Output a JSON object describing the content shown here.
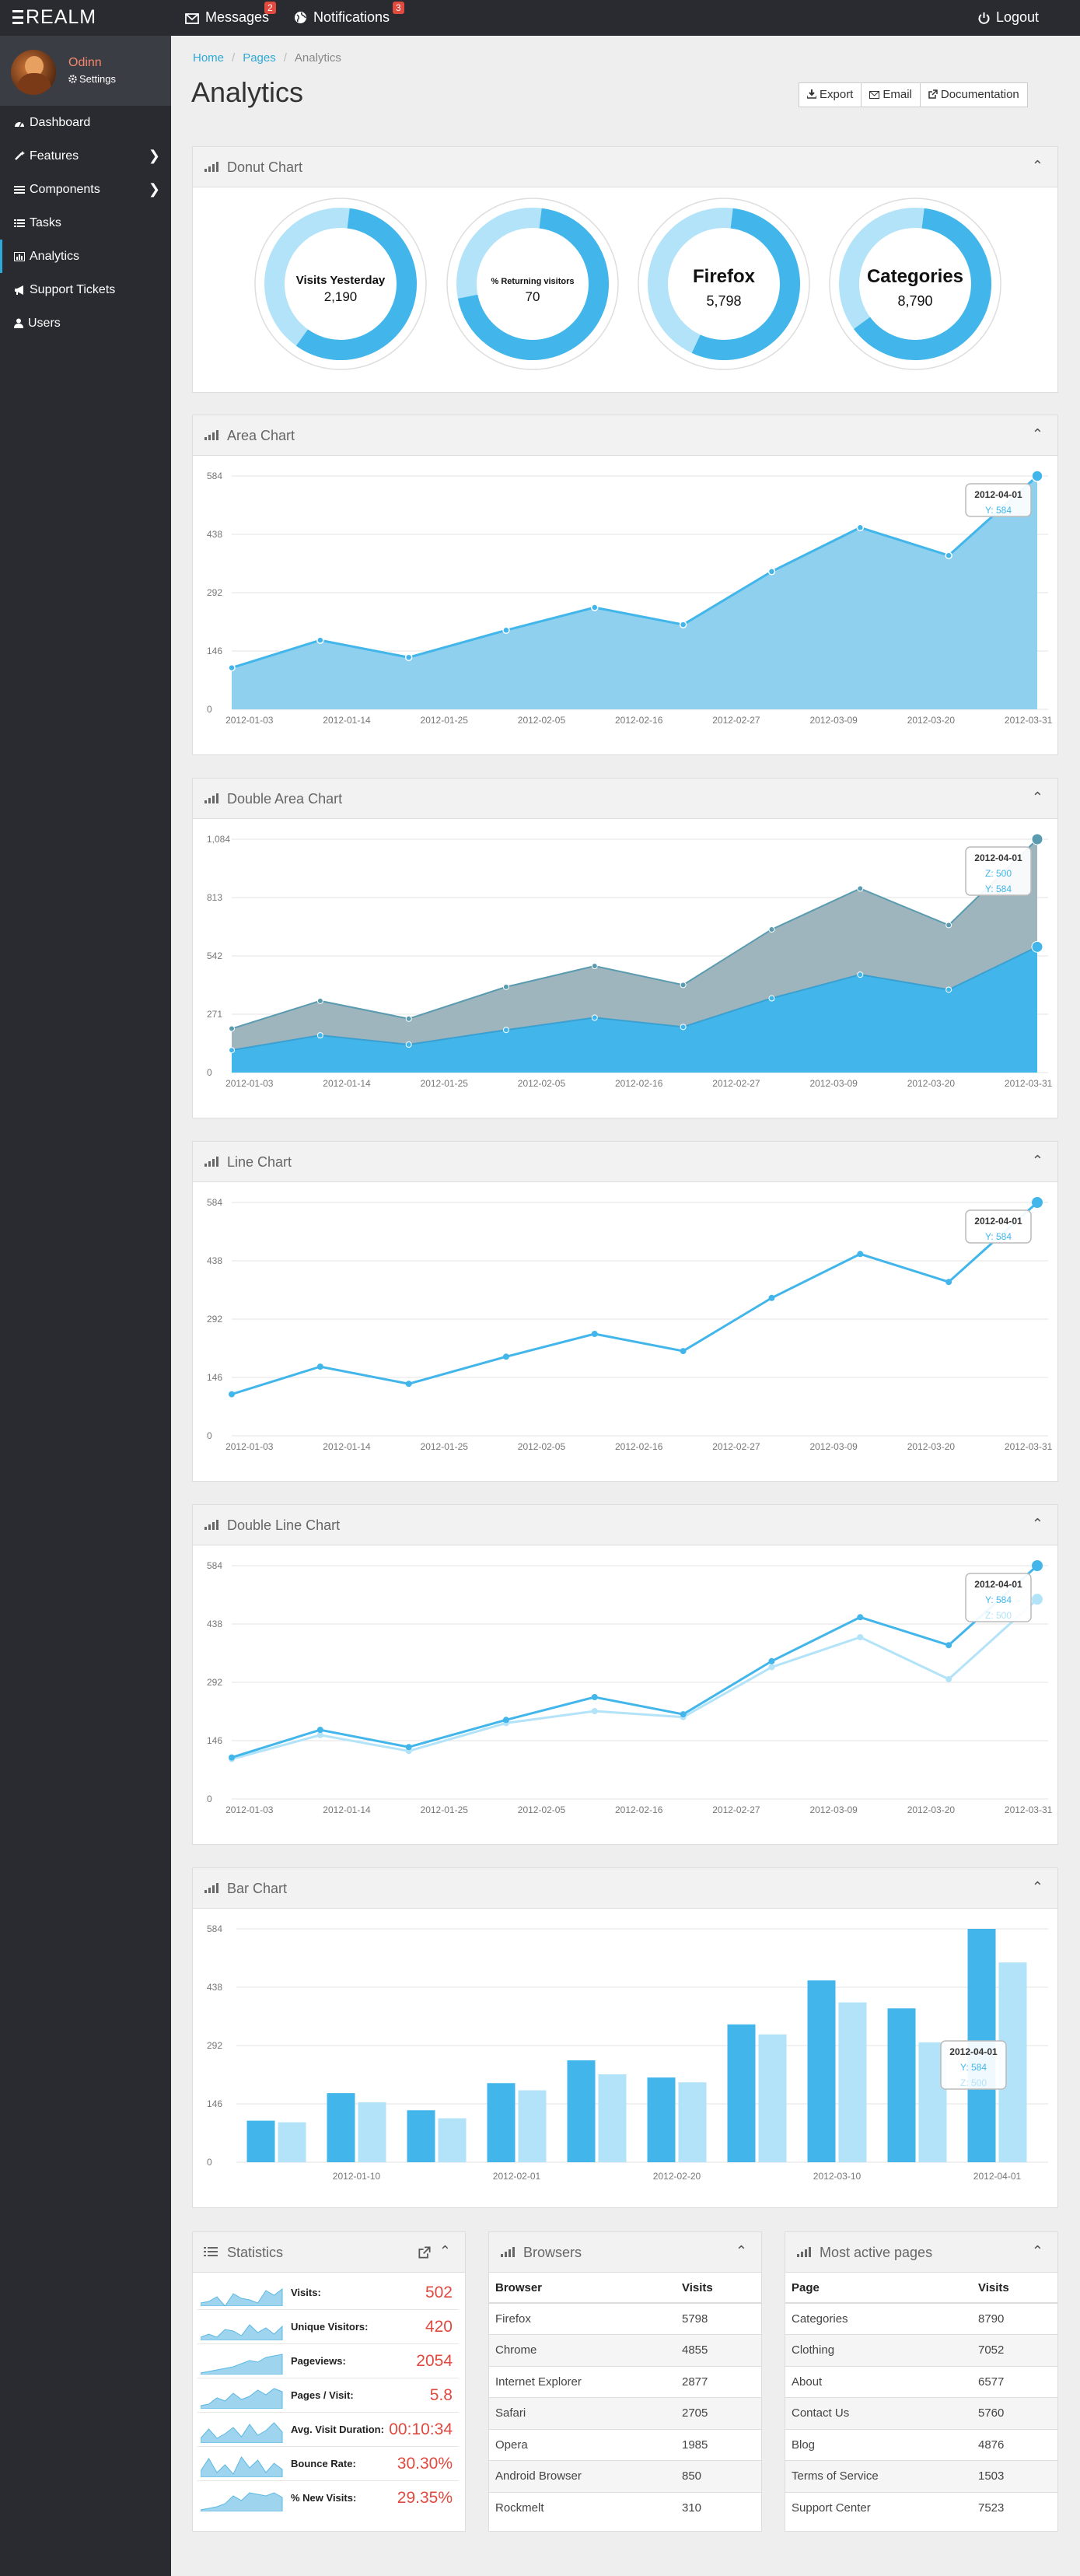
{
  "app": {
    "brand": "REALM"
  },
  "topbar": {
    "messages_label": "Messages",
    "messages_badge": "2",
    "notifications_label": "Notifications",
    "notifications_badge": "3",
    "logout_label": "Logout"
  },
  "sidebar": {
    "user_name": "Odinn",
    "settings_label": "Settings",
    "items": [
      {
        "label": "Dashboard",
        "icon": "dashboard-icon"
      },
      {
        "label": "Features",
        "icon": "magic-icon"
      },
      {
        "label": "Components",
        "icon": "bars-icon"
      },
      {
        "label": "Tasks",
        "icon": "list-icon"
      },
      {
        "label": "Analytics",
        "icon": "bar-chart-icon"
      },
      {
        "label": "Support Tickets",
        "icon": "bullhorn-icon"
      },
      {
        "label": "Users",
        "icon": "user-icon"
      }
    ]
  },
  "breadcrumb": {
    "home": "Home",
    "pages": "Pages",
    "current": "Analytics"
  },
  "page": {
    "title": "Analytics"
  },
  "actions": {
    "export": "Export",
    "email": "Email",
    "documentation": "Documentation"
  },
  "colors": {
    "accent": "#2ea8d6",
    "series_a": "#42b6ea",
    "series_b": "#b3e3f8",
    "danger": "#e04a3f",
    "area_fill": "#8fd0ee",
    "double_area_upper": "#9eb5bd"
  },
  "panels": {
    "donut": "Donut Chart",
    "area": "Area Chart",
    "double_area": "Double Area Chart",
    "line": "Line Chart",
    "double_line": "Double Line Chart",
    "bar": "Bar Chart",
    "statistics": "Statistics",
    "browsers": "Browsers",
    "pages": "Most active pages"
  },
  "chart_data": [
    {
      "type": "pie",
      "title": "Donut Chart",
      "donuts": [
        {
          "label": "Visits Yesterday",
          "value": "2,190"
        },
        {
          "label": "% Returning visitors",
          "value": "70"
        },
        {
          "label": "Firefox",
          "value": "5,798"
        },
        {
          "label": "Categories",
          "value": "8,790"
        }
      ]
    },
    {
      "type": "area",
      "title": "Area Chart",
      "x": [
        "2012-01-03",
        "2012-01-14",
        "2012-01-25",
        "2012-02-05",
        "2012-02-16",
        "2012-02-27",
        "2012-03-09",
        "2012-03-20",
        "2012-03-31"
      ],
      "yticks": [
        0,
        146,
        292,
        438,
        584
      ],
      "ylim": [
        0,
        584
      ],
      "points": [
        [
          "2012-01-01",
          104
        ],
        [
          "2012-01-11",
          173
        ],
        [
          "2012-01-21",
          130
        ],
        [
          "2012-02-01",
          198
        ],
        [
          "2012-02-11",
          255
        ],
        [
          "2012-02-21",
          212
        ],
        [
          "2012-03-02",
          345
        ],
        [
          "2012-03-12",
          455
        ],
        [
          "2012-03-22",
          385
        ],
        [
          "2012-04-01",
          584
        ]
      ],
      "series": [
        {
          "name": "Y",
          "values": [
            104,
            173,
            130,
            198,
            255,
            212,
            345,
            455,
            385,
            584
          ]
        }
      ],
      "tooltip": {
        "title": "2012-04-01",
        "lines": [
          {
            "text": "Y: 584",
            "color": "#42b6ea"
          }
        ]
      }
    },
    {
      "type": "area",
      "title": "Double Area Chart",
      "x": [
        "2012-01-03",
        "2012-01-14",
        "2012-01-25",
        "2012-02-05",
        "2012-02-16",
        "2012-02-27",
        "2012-03-09",
        "2012-03-20",
        "2012-03-31"
      ],
      "yticks": [
        0,
        271,
        542,
        813,
        "1,084"
      ],
      "ylim": [
        0,
        1084
      ],
      "dates": [
        "2012-01-01",
        "2012-01-11",
        "2012-01-21",
        "2012-02-01",
        "2012-02-11",
        "2012-02-21",
        "2012-03-02",
        "2012-03-12",
        "2012-03-22",
        "2012-04-01"
      ],
      "series": [
        {
          "name": "Y",
          "values": [
            104,
            173,
            130,
            198,
            255,
            212,
            345,
            455,
            385,
            584
          ]
        },
        {
          "name": "Z",
          "values": [
            100,
            160,
            120,
            200,
            240,
            195,
            320,
            400,
            300,
            500
          ]
        }
      ],
      "tooltip": {
        "title": "2012-04-01",
        "lines": [
          {
            "text": "Z: 500",
            "color": "#42b6ea"
          },
          {
            "text": "Y: 584",
            "color": "#42b6ea"
          }
        ]
      }
    },
    {
      "type": "line",
      "title": "Line Chart",
      "x": [
        "2012-01-03",
        "2012-01-14",
        "2012-01-25",
        "2012-02-05",
        "2012-02-16",
        "2012-02-27",
        "2012-03-09",
        "2012-03-20",
        "2012-03-31"
      ],
      "yticks": [
        0,
        146,
        292,
        438,
        584
      ],
      "ylim": [
        0,
        584
      ],
      "dates": [
        "2012-01-01",
        "2012-01-11",
        "2012-01-21",
        "2012-02-01",
        "2012-02-11",
        "2012-02-21",
        "2012-03-02",
        "2012-03-12",
        "2012-03-22",
        "2012-04-01"
      ],
      "series": [
        {
          "name": "Y",
          "values": [
            104,
            173,
            130,
            198,
            255,
            212,
            345,
            455,
            385,
            584
          ]
        }
      ],
      "tooltip": {
        "title": "2012-04-01",
        "lines": [
          {
            "text": "Y: 584",
            "color": "#42b6ea"
          }
        ]
      }
    },
    {
      "type": "line",
      "title": "Double Line Chart",
      "x": [
        "2012-01-03",
        "2012-01-14",
        "2012-01-25",
        "2012-02-05",
        "2012-02-16",
        "2012-02-27",
        "2012-03-09",
        "2012-03-20",
        "2012-03-31"
      ],
      "yticks": [
        0,
        146,
        292,
        438,
        584
      ],
      "ylim": [
        0,
        584
      ],
      "dates": [
        "2012-01-01",
        "2012-01-11",
        "2012-01-21",
        "2012-02-01",
        "2012-02-11",
        "2012-02-21",
        "2012-03-02",
        "2012-03-12",
        "2012-03-22",
        "2012-04-01"
      ],
      "series": [
        {
          "name": "Y",
          "values": [
            104,
            173,
            130,
            198,
            255,
            212,
            345,
            455,
            385,
            584
          ]
        },
        {
          "name": "Z",
          "values": [
            100,
            160,
            120,
            190,
            220,
            205,
            330,
            405,
            300,
            500
          ]
        }
      ],
      "tooltip": {
        "title": "2012-04-01",
        "lines": [
          {
            "text": "Y: 584",
            "color": "#42b6ea"
          },
          {
            "text": "Z: 500",
            "color": "#b3e3f8"
          }
        ]
      }
    },
    {
      "type": "bar",
      "title": "Bar Chart",
      "x": [
        "2012-01-10",
        "2012-02-01",
        "2012-02-20",
        "2012-03-10",
        "2012-04-01"
      ],
      "yticks": [
        0,
        146,
        292,
        438,
        584
      ],
      "ylim": [
        0,
        584
      ],
      "categories": [
        "2012-01-01",
        "2012-01-11",
        "2012-01-21",
        "2012-02-01",
        "2012-02-11",
        "2012-02-21",
        "2012-03-02",
        "2012-03-12",
        "2012-03-22",
        "2012-04-01"
      ],
      "series": [
        {
          "name": "Y",
          "values": [
            104,
            173,
            130,
            198,
            255,
            212,
            345,
            455,
            385,
            584
          ]
        },
        {
          "name": "Z",
          "values": [
            100,
            150,
            110,
            180,
            220,
            200,
            320,
            400,
            300,
            500
          ]
        }
      ],
      "tooltip": {
        "title": "2012-04-01",
        "lines": [
          {
            "text": "Y: 584",
            "color": "#42b6ea"
          },
          {
            "text": "Z: 500",
            "color": "#b3e3f8"
          }
        ]
      }
    }
  ],
  "statistics": [
    {
      "label": "Visits:",
      "value": "502"
    },
    {
      "label": "Unique Visitors:",
      "value": "420"
    },
    {
      "label": "Pageviews:",
      "value": "2054"
    },
    {
      "label": "Pages / Visit:",
      "value": "5.8"
    },
    {
      "label": "Avg. Visit Duration:",
      "value": "00:10:34"
    },
    {
      "label": "Bounce Rate:",
      "value": "30.30%"
    },
    {
      "label": "% New Visits:",
      "value": "29.35%"
    }
  ],
  "browsers": {
    "headers": [
      "Browser",
      "Visits"
    ],
    "rows": [
      [
        "Firefox",
        "5798"
      ],
      [
        "Chrome",
        "4855"
      ],
      [
        "Internet Explorer",
        "2877"
      ],
      [
        "Safari",
        "2705"
      ],
      [
        "Opera",
        "1985"
      ],
      [
        "Android Browser",
        "850"
      ],
      [
        "Rockmelt",
        "310"
      ]
    ]
  },
  "pages": {
    "headers": [
      "Page",
      "Visits"
    ],
    "rows": [
      [
        "Categories",
        "8790"
      ],
      [
        "Clothing",
        "7052"
      ],
      [
        "About",
        "6577"
      ],
      [
        "Contact Us",
        "5760"
      ],
      [
        "Blog",
        "4876"
      ],
      [
        "Terms of Service",
        "1503"
      ],
      [
        "Support Center",
        "7523"
      ]
    ]
  }
}
